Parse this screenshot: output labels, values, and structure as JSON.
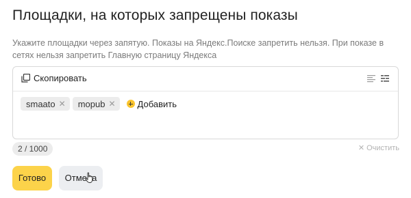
{
  "title": "Площадки, на которых запрещены показы",
  "description": "Укажите площадки через запятую. Показы на Яндекс.Поиске запретить нельзя. При показе в сетях нельзя запретить Главную страницу Яндекса",
  "editor": {
    "copy_label": "Скопировать",
    "copy_icon": "copy-icon",
    "toolbar_icons": [
      "text-view-icon",
      "tag-view-icon"
    ],
    "tags": [
      {
        "label": "smaato"
      },
      {
        "label": "mopub"
      }
    ],
    "add_label": "Добавить"
  },
  "counter": "2 / 1000",
  "clear_label": "Очистить",
  "buttons": {
    "done": "Готово",
    "cancel": "Отмена"
  },
  "colors": {
    "accent": "#fcd34a",
    "add_icon": "#fbc52e",
    "muted_text": "#7a7a7a"
  }
}
